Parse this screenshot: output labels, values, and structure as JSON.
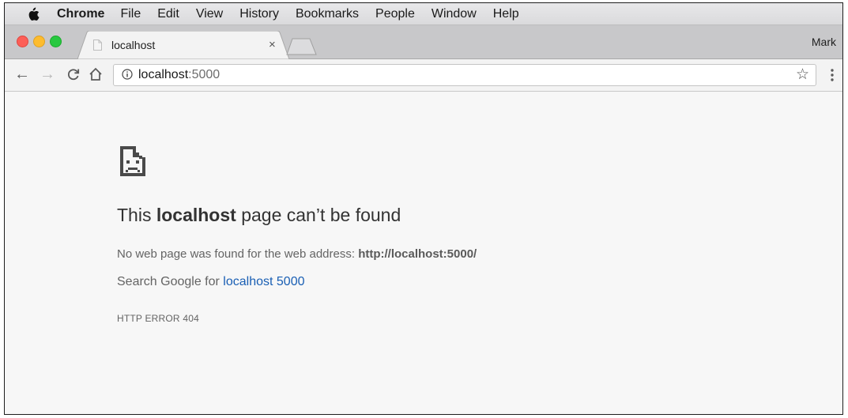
{
  "menubar": {
    "app": "Chrome",
    "items": [
      "File",
      "Edit",
      "View",
      "History",
      "Bookmarks",
      "People",
      "Window",
      "Help"
    ]
  },
  "tabs": [
    {
      "title": "localhost",
      "close": "×"
    }
  ],
  "profile": "Mark",
  "toolbar": {
    "url_host": "localhost",
    "url_port": ":5000",
    "star": "☆"
  },
  "error_page": {
    "heading_pre": "This ",
    "heading_bold": "localhost",
    "heading_post": " page can’t be found",
    "desc_text": "No web page was found for the web address: ",
    "desc_url": "http://localhost:5000/",
    "search_text": "Search Google for ",
    "search_link": "localhost 5000",
    "error_code": "HTTP ERROR 404"
  },
  "colors": {
    "link": "#1a5fb4",
    "close_red": "#fc5f57",
    "minimize_yellow": "#fdbc2e",
    "maximize_green": "#28c840"
  }
}
